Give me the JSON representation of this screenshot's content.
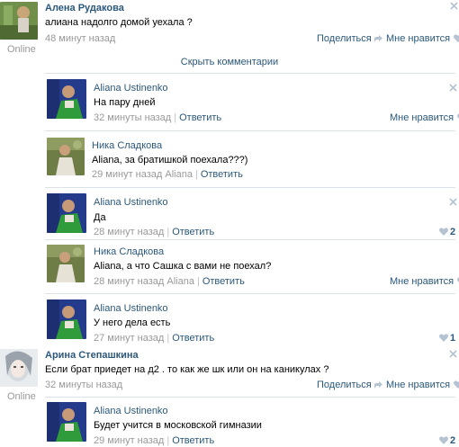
{
  "posts": [
    {
      "author": "Алена Рудакова",
      "text": "алиана надолго домой уехала ?",
      "time": "48 минут назад",
      "share_label": "Поделиться",
      "like_label": "Мне нравится",
      "online": "Online"
    },
    {
      "author": "Арина Степашкина",
      "text": "Если брат приедет на д2 . то как же шк или он на каникулах ?",
      "time": "32 минуты назад",
      "share_label": "Поделиться",
      "like_label": "Мне нравится",
      "online": "Online"
    }
  ],
  "hide_comments_label": "Скрыть комментарии",
  "comments": [
    {
      "author": "Aliana Ustinenko",
      "text": "На пару дней",
      "time": "32 минуты назад",
      "reply_label": "Ответить",
      "like_label": "Мне нравится"
    },
    {
      "author": "Ника Сладкова",
      "text": "Aliana, за братишкой поехала???)",
      "time": "29 минут назад",
      "reply_to": "Aliana",
      "reply_label": "Ответить"
    },
    {
      "author": "Aliana Ustinenko",
      "text": "Да",
      "time": "28 минут назад",
      "reply_label": "Ответить",
      "likes": "2"
    },
    {
      "author": "Ника Сладкова",
      "text": "Aliana, а что Сашка с вами не поехал?",
      "time": "28 минут назад",
      "reply_to": "Aliana",
      "reply_label": "Ответить",
      "like_label": "Мне нравится"
    },
    {
      "author": "Aliana Ustinenko",
      "text": "У него дела есть",
      "time": "27 минут назад",
      "reply_label": "Ответить",
      "likes": "1"
    },
    {
      "author": "Aliana Ustinenko",
      "text": "Будет учится в московской гимназии",
      "time": "29 минут назад",
      "reply_label": "Ответить",
      "likes": "2"
    }
  ],
  "colors": {
    "link": "#2b587a",
    "meta": "#999999",
    "divider": "#dae1e8",
    "icon": "#b4c2d1"
  },
  "icons": [
    "close-icon",
    "heart-icon",
    "share-icon"
  ]
}
